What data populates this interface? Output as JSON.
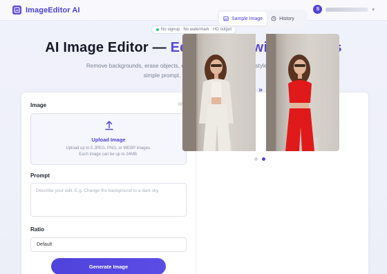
{
  "header": {
    "brand": "ImageEditor AI",
    "user_initial": "S"
  },
  "badge": {
    "text": "No signup · No watermark · HD output"
  },
  "hero": {
    "title_main": "AI Image Editor — ",
    "title_accent": "Edit Photos with Prompts",
    "subtitle": "Remove backgrounds, erase objects, enhance quality, and transfer styles — all with a simple prompt. No design skills needed."
  },
  "form": {
    "image_label": "Image",
    "image_count": "0/5",
    "upload_title": "Upload Image",
    "upload_hint_1": "Upload up to 5 JPEG, PNG, or WEBP images.",
    "upload_hint_2": "Each image can be up to 24MB.",
    "prompt_label": "Prompt",
    "prompt_placeholder": "Describe your edit. E.g. Change the background to a dark sky.",
    "ratio_label": "Ratio",
    "ratio_value": "Default",
    "generate_label": "Generate Image"
  },
  "preview": {
    "tabs": [
      {
        "label": "Sample Image",
        "active": true
      },
      {
        "label": "History",
        "active": false
      }
    ],
    "carousel_dots": 2,
    "active_dot": 2
  },
  "colors": {
    "accent": "#5546dd",
    "outfit_before": "#eeeae4",
    "outfit_after": "#e01a1a"
  }
}
